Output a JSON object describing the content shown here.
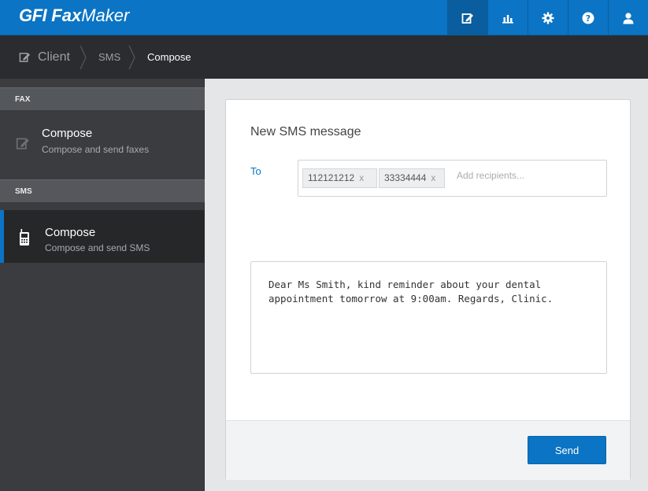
{
  "app": {
    "brand_gfi": "GFI",
    "brand_fax": "Fax",
    "brand_maker": "Maker"
  },
  "topnav": [
    {
      "icon": "compose-icon",
      "active": true
    },
    {
      "icon": "bar-chart-icon",
      "active": false
    },
    {
      "icon": "gear-icon",
      "active": false
    },
    {
      "icon": "help-icon",
      "active": false
    },
    {
      "icon": "user-icon",
      "active": false
    }
  ],
  "breadcrumb": {
    "root": "Client",
    "level1": "SMS",
    "level2": "Compose"
  },
  "sidebar": {
    "fax_header": "FAX",
    "fax_item": {
      "title": "Compose",
      "subtitle": "Compose and send faxes"
    },
    "sms_header": "SMS",
    "sms_item": {
      "title": "Compose",
      "subtitle": "Compose and send SMS"
    }
  },
  "form": {
    "title": "New SMS message",
    "to_label": "To",
    "recipients": [
      "112121212",
      "33334444"
    ],
    "remove_glyph": "x",
    "recipients_placeholder": "Add recipients...",
    "message": "Dear Ms Smith, kind reminder about your dental appointment tomorrow at 9:00am. Regards, Clinic.",
    "send_label": "Send"
  },
  "colors": {
    "accent": "#0b74c4",
    "sidebar_bg": "#3a3c3f",
    "breadcrumb_bg": "#2a2c2f"
  }
}
